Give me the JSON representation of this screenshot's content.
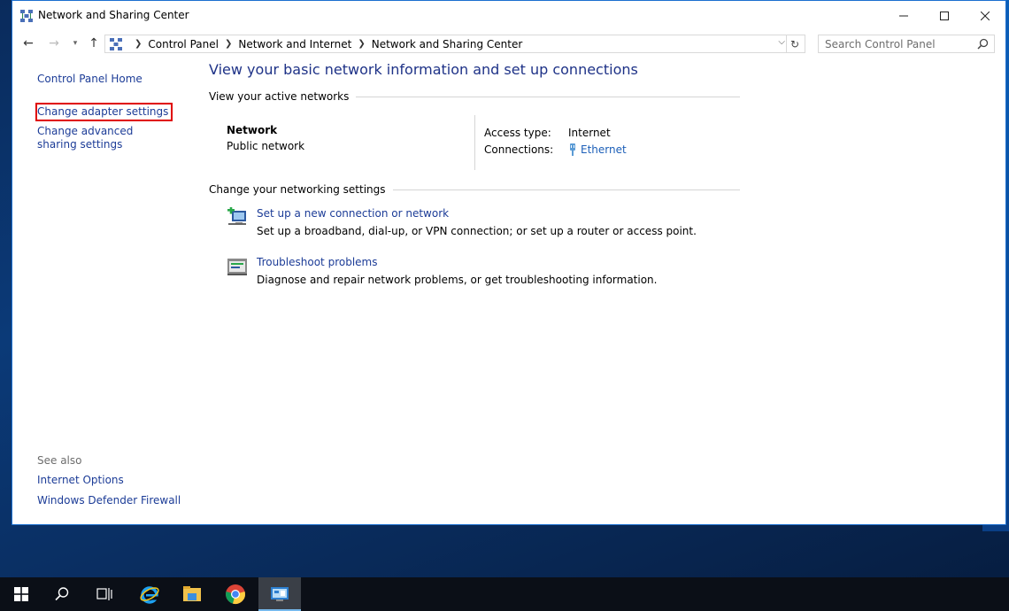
{
  "window": {
    "title": "Network and Sharing Center",
    "icon": "network-center-icon"
  },
  "caption_buttons": {
    "minimize": "minimize-icon",
    "maximize": "maximize-icon",
    "close": "close-icon"
  },
  "address": {
    "breadcrumb": [
      "Control Panel",
      "Network and Internet",
      "Network and Sharing Center"
    ]
  },
  "search": {
    "placeholder": "Search Control Panel"
  },
  "sidebar": {
    "home": "Control Panel Home",
    "adapter": "Change adapter settings",
    "advanced": "Change advanced sharing settings",
    "see_also_title": "See also",
    "see_also": [
      "Internet Options",
      "Windows Defender Firewall"
    ]
  },
  "main": {
    "title": "View your basic network information and set up connections",
    "active_networks_heading": "View your active networks",
    "network": {
      "name": "Network",
      "type": "Public network",
      "access_type_label": "Access type:",
      "access_type_value": "Internet",
      "connections_label": "Connections:",
      "connections_value": "Ethernet"
    },
    "change_heading": "Change your networking settings",
    "tasks": [
      {
        "link": "Set up a new connection or network",
        "desc": "Set up a broadband, dial-up, or VPN connection; or set up a router or access point.",
        "icon": "new-connection-icon"
      },
      {
        "link": "Troubleshoot problems",
        "desc": "Diagnose and repair network problems, or get troubleshooting information.",
        "icon": "troubleshoot-icon"
      }
    ]
  },
  "taskbar": {
    "items": [
      "start-icon",
      "search-icon",
      "task-view-icon",
      "internet-explorer-icon",
      "file-explorer-icon",
      "chrome-icon",
      "control-panel-icon"
    ]
  },
  "colors": {
    "link": "#1c3c97",
    "title": "#1e3287",
    "highlight_border": "#e00000"
  }
}
